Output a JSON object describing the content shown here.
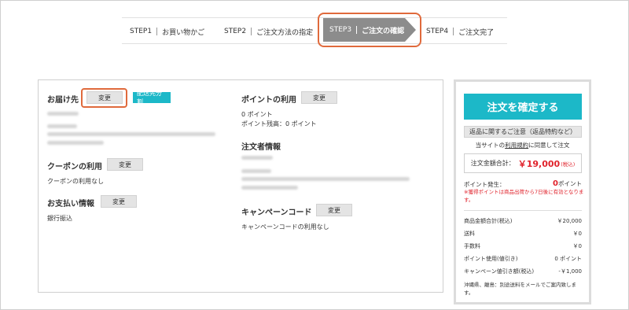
{
  "steps": [
    {
      "num": "STEP1",
      "label": "お買い物かご"
    },
    {
      "num": "STEP2",
      "label": "ご注文方法の指定"
    },
    {
      "num": "STEP3",
      "label": "ご注文の確認"
    },
    {
      "num": "STEP4",
      "label": "ご注文完了"
    }
  ],
  "delivery": {
    "title": "お届け先",
    "change_label": "変更",
    "split_label": "配送先分割"
  },
  "coupon": {
    "title": "クーポンの利用",
    "change_label": "変更",
    "value": "クーポンの利用なし"
  },
  "payment": {
    "title": "お支払い情報",
    "change_label": "変更",
    "value": "銀行振込"
  },
  "points": {
    "title": "ポイントの利用",
    "change_label": "変更",
    "used": "0 ポイント",
    "balance": "ポイント残高：0 ポイント"
  },
  "orderer": {
    "title": "注文者情報"
  },
  "campaign": {
    "title": "キャンペーンコード",
    "change_label": "変更",
    "value": "キャンペーンコードの利用なし"
  },
  "summary": {
    "confirm_label": "注文を確定する",
    "return_label": "返品に関するご注意（返品特約など）",
    "agree_prefix": "当サイトの",
    "agree_link": "利用規約",
    "agree_suffix": "に同意して注文",
    "total_label": "注文金額合計：",
    "total_value": "￥19,000",
    "total_tax": "(税込)",
    "point_label": "ポイント発生：",
    "point_value": "0",
    "point_unit": "ポイント",
    "point_note": "※獲得ポイントは商品出荷から7日後に有効となります。",
    "rows": [
      {
        "label": "商品金額合計(税込)",
        "value": "￥20,000"
      },
      {
        "label": "送料",
        "value": "￥0"
      },
      {
        "label": "手数料",
        "value": "￥0"
      },
      {
        "label": "ポイント使用(値引き)",
        "value": "0 ポイント"
      },
      {
        "label": "キャンペーン値引き額(税込)",
        "value": "-￥1,000"
      }
    ],
    "note": "沖縄県、離島：別途送料をメールでご案内致します。"
  },
  "colors": {
    "accent": "#1cb8c8",
    "highlight": "#e06a3c",
    "price": "#e0222b",
    "step_active": "#8c8c8c"
  }
}
